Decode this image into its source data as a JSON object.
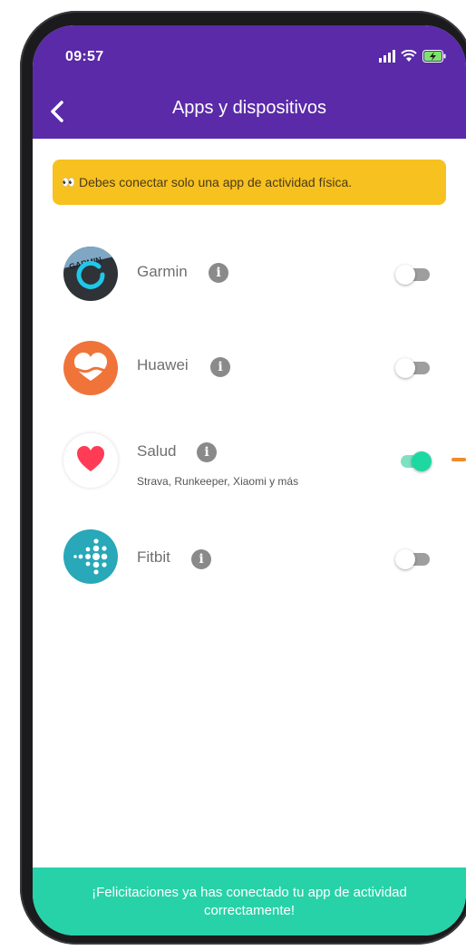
{
  "status_bar": {
    "time": "09:57"
  },
  "header": {
    "title": "Apps y dispositivos",
    "background": "#5a2aa8"
  },
  "warning": {
    "emoji": "👀",
    "text": "Debes conectar solo una app de actividad física.",
    "background": "#f7c11f"
  },
  "apps": [
    {
      "name": "Garmin",
      "icon": "garmin-icon",
      "connected": false
    },
    {
      "name": "Huawei",
      "icon": "huawei-health-icon",
      "connected": false
    },
    {
      "name": "Salud",
      "icon": "apple-health-icon",
      "connected": true,
      "subtitle": "Strava, Runkeeper, Xiaomi y más"
    },
    {
      "name": "Fitbit",
      "icon": "fitbit-icon",
      "connected": false
    }
  ],
  "footer": {
    "line1": "¡Felicitaciones ya has conectado tu app de actividad",
    "line2": "correctamente!",
    "background": "#27d2a8"
  },
  "garmin_logo_text": "GARMIN"
}
